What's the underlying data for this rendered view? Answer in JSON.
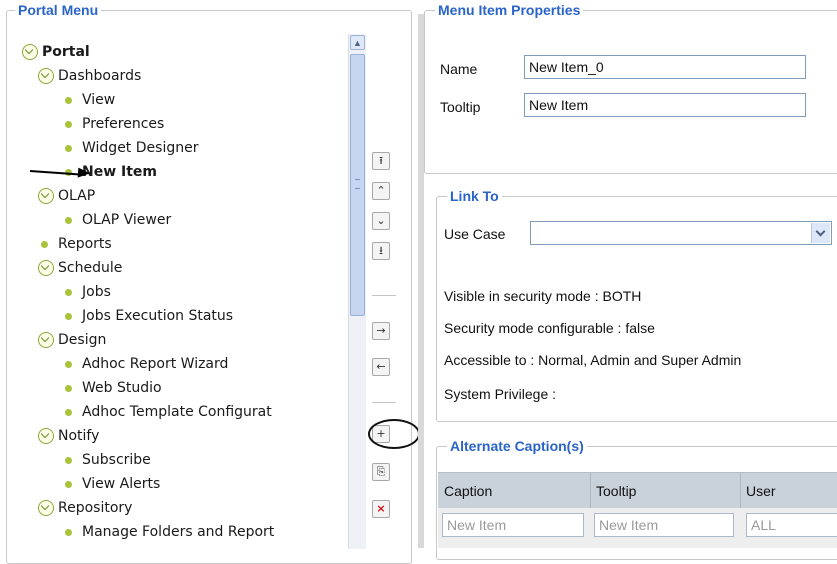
{
  "portal_menu": {
    "title": "Portal Menu",
    "tree": [
      {
        "label": "Portal"
      },
      {
        "label": "Dashboards"
      },
      {
        "label": "View"
      },
      {
        "label": "Preferences"
      },
      {
        "label": "Widget Designer"
      },
      {
        "label": "New Item"
      },
      {
        "label": "OLAP"
      },
      {
        "label": "OLAP Viewer"
      },
      {
        "label": "Reports"
      },
      {
        "label": "Schedule"
      },
      {
        "label": "Jobs"
      },
      {
        "label": "Jobs Execution Status"
      },
      {
        "label": "Design"
      },
      {
        "label": "Adhoc Report Wizard"
      },
      {
        "label": "Web Studio"
      },
      {
        "label": "Adhoc Template Configurat"
      },
      {
        "label": "Notify"
      },
      {
        "label": "Subscribe"
      },
      {
        "label": "View Alerts"
      },
      {
        "label": "Repository"
      },
      {
        "label": "Manage Folders and Report"
      }
    ]
  },
  "toolbar": {
    "move_top": "⭱",
    "move_up": "⌃",
    "move_down": "⌄",
    "move_bottom": "⭳",
    "indent": "→",
    "outdent": "←",
    "add": "+",
    "copy": "⎘",
    "delete": "×"
  },
  "properties": {
    "title": "Menu Item Properties",
    "name_label": "Name",
    "name_value": "New Item_0",
    "tooltip_label": "Tooltip",
    "tooltip_value": "New Item"
  },
  "link_to": {
    "title": "Link To",
    "use_case_label": "Use Case",
    "use_case_value": "",
    "visible_security": "Visible in security mode : BOTH",
    "security_configurable": "Security mode configurable : false",
    "accessible_to": "Accessible to : Normal, Admin and Super Admin",
    "system_privilege": "System Privilege :"
  },
  "captions": {
    "title": "Alternate Caption(s)",
    "headers": [
      "Caption",
      "Tooltip",
      "User"
    ],
    "row": {
      "caption": "New Item",
      "tooltip": "New Item",
      "user": "ALL"
    }
  }
}
